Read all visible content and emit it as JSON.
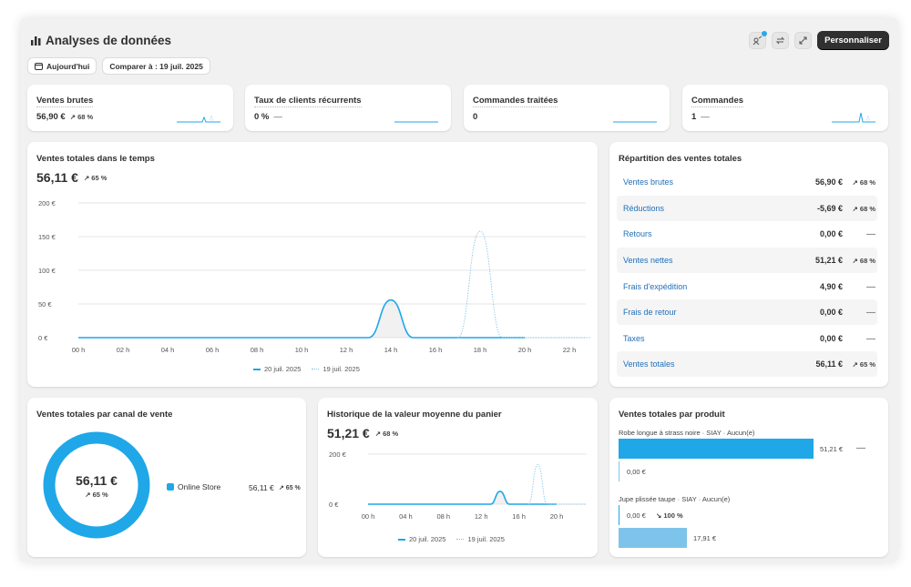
{
  "header": {
    "title": "Analyses de données",
    "customize_label": "Personnaliser",
    "today_label": "Aujourd'hui",
    "compare_label": "Comparer à : 19 juil. 2025"
  },
  "kpis": [
    {
      "title": "Ventes brutes",
      "value": "56,90 €",
      "change": "↗ 68 %"
    },
    {
      "title": "Taux de clients récurrents",
      "value": "0 %",
      "change": "—"
    },
    {
      "title": "Commandes traitées",
      "value": "0",
      "change": ""
    },
    {
      "title": "Commandes",
      "value": "1",
      "change": "—"
    }
  ],
  "sales_over_time": {
    "title": "Ventes totales dans le temps",
    "value": "56,11 €",
    "change": "↗ 65 %",
    "legend_current": "20 juil. 2025",
    "legend_previous": "19 juil. 2025"
  },
  "breakdown": {
    "title": "Répartition des ventes totales",
    "rows": [
      {
        "label": "Ventes brutes",
        "value": "56,90 €",
        "change": "↗ 68 %"
      },
      {
        "label": "Réductions",
        "value": "-5,69 €",
        "change": "↗ 68 %"
      },
      {
        "label": "Retours",
        "value": "0,00 €",
        "change": "—"
      },
      {
        "label": "Ventes nettes",
        "value": "51,21 €",
        "change": "↗ 68 %"
      },
      {
        "label": "Frais d'expédition",
        "value": "4,90 €",
        "change": "—"
      },
      {
        "label": "Frais de retour",
        "value": "0,00 €",
        "change": "—"
      },
      {
        "label": "Taxes",
        "value": "0,00 €",
        "change": "—"
      },
      {
        "label": "Ventes totales",
        "value": "56,11 €",
        "change": "↗ 65 %"
      }
    ]
  },
  "channel": {
    "title": "Ventes totales par canal de vente",
    "center_value": "56,11 €",
    "center_change": "↗ 65 %",
    "channel_name": "Online Store",
    "channel_value": "56,11 €",
    "channel_change": "↗ 65 %"
  },
  "aov": {
    "title": "Historique de la valeur moyenne du panier",
    "value": "51,21 €",
    "change": "↗ 68 %",
    "legend_current": "20 juil. 2025",
    "legend_previous": "19 juil. 2025"
  },
  "products": {
    "title": "Ventes totales par produit",
    "items": [
      {
        "name": "Robe longue à strass noire · SIAY · Aucun(e)",
        "current_value": "51,21 €",
        "current_change": "—",
        "previous_value": "0,00 €"
      },
      {
        "name": "Jupe plissée taupe · SIAY · Aucun(e)",
        "current_value": "0,00 €",
        "current_change": "↘ 100 %",
        "previous_value": "17,91 €"
      }
    ]
  },
  "colors": {
    "accent": "#1fa7e8",
    "previous": "#7ec4ea",
    "dark": "#303030"
  },
  "chart_data": [
    {
      "type": "line",
      "title": "Ventes totales dans le temps",
      "x_ticks": [
        "00 h",
        "02 h",
        "04 h",
        "06 h",
        "08 h",
        "10 h",
        "12 h",
        "14 h",
        "16 h",
        "18 h",
        "20 h",
        "22 h"
      ],
      "y_ticks": [
        "0 €",
        "50 €",
        "100 €",
        "150 €",
        "200 €"
      ],
      "ylim": [
        0,
        200
      ],
      "series": [
        {
          "name": "20 juil. 2025",
          "style": "solid",
          "points": [
            [
              0,
              0
            ],
            [
              13,
              0
            ],
            [
              14,
              56
            ],
            [
              15,
              0
            ],
            [
              20,
              0
            ]
          ]
        },
        {
          "name": "19 juil. 2025",
          "style": "dotted",
          "points": [
            [
              17,
              0
            ],
            [
              18,
              158
            ],
            [
              19,
              0
            ],
            [
              23,
              0
            ]
          ]
        }
      ]
    },
    {
      "type": "line",
      "title": "Historique de la valeur moyenne du panier",
      "x_ticks": [
        "00 h",
        "04 h",
        "08 h",
        "12 h",
        "16 h",
        "20 h"
      ],
      "y_ticks": [
        "0 €",
        "200 €"
      ],
      "ylim": [
        0,
        200
      ],
      "series": [
        {
          "name": "20 juil. 2025",
          "style": "solid",
          "points": [
            [
              0,
              0
            ],
            [
              13,
              0
            ],
            [
              14,
              51
            ],
            [
              15,
              0
            ],
            [
              20,
              0
            ]
          ]
        },
        {
          "name": "19 juil. 2025",
          "style": "dotted",
          "points": [
            [
              17,
              0
            ],
            [
              18,
              158
            ],
            [
              19,
              0
            ],
            [
              23,
              0
            ]
          ]
        }
      ]
    },
    {
      "type": "pie",
      "title": "Ventes totales par canal de vente",
      "slices": [
        {
          "label": "Online Store",
          "value": 56.11
        }
      ]
    },
    {
      "type": "bar",
      "title": "Ventes totales par produit",
      "categories": [
        "Robe longue à strass noire · SIAY · Aucun(e)",
        "Jupe plissée taupe · SIAY · Aucun(e)"
      ],
      "series": [
        {
          "name": "20 juil. 2025",
          "values": [
            51.21,
            0
          ]
        },
        {
          "name": "19 juil. 2025",
          "values": [
            0,
            17.91
          ]
        }
      ]
    }
  ]
}
